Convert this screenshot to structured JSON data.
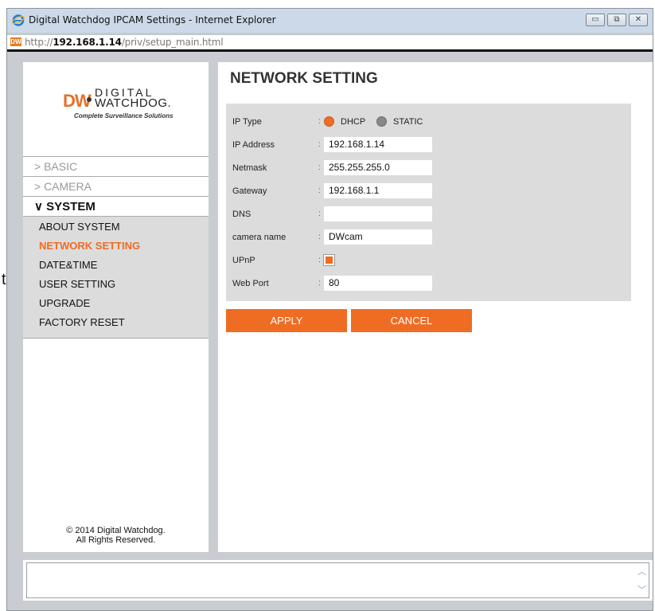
{
  "background_char": "t",
  "window": {
    "title": "Digital Watchdog IPCAM Settings - Internet Explorer",
    "url_prefix": "http://",
    "url_host": "192.168.1.14",
    "url_path": "/priv/setup_main.html",
    "favicon_text": "DW",
    "buttons": {
      "minimize": "▭",
      "restore": "⧉",
      "close": "✕"
    }
  },
  "logo": {
    "dw": "DW",
    "digital": "DIGITAL",
    "watchdog": "WATCHDOG.",
    "tagline": "Complete Surveillance Solutions"
  },
  "menu": {
    "basic": "> BASIC",
    "camera": "> CAMERA",
    "system": "∨ SYSTEM",
    "submenu": [
      "ABOUT SYSTEM",
      "NETWORK SETTING",
      "DATE&TIME",
      "USER SETTING",
      "UPGRADE",
      "FACTORY RESET"
    ],
    "active_index": 1
  },
  "copyright": {
    "line1": "© 2014 Digital Watchdog.",
    "line2": "All Rights Reserved."
  },
  "page": {
    "title": "NETWORK SETTING",
    "fields": {
      "ip_type_label": "IP Type",
      "dhcp_label": "DHCP",
      "static_label": "STATIC",
      "ip_type_selected": "DHCP",
      "ip_address_label": "IP Address",
      "ip_address": "192.168.1.14",
      "netmask_label": "Netmask",
      "netmask": "255.255.255.0",
      "gateway_label": "Gateway",
      "gateway": "192.168.1.1",
      "dns_label": "DNS",
      "dns": "",
      "camera_name_label": "camera name",
      "camera_name": "DWcam",
      "upnp_label": "UPnP",
      "upnp_checked": true,
      "web_port_label": "Web Port",
      "web_port": "80"
    },
    "apply_label": "APPLY",
    "cancel_label": "CANCEL"
  },
  "colors": {
    "accent": "#ef6c23",
    "panel_gray": "#dcdcdc",
    "window_bg": "#c9ccd0"
  },
  "icons": [
    "ie-icon",
    "minimize-icon",
    "restore-icon",
    "close-icon",
    "scroll-up-icon",
    "scroll-down-icon"
  ]
}
